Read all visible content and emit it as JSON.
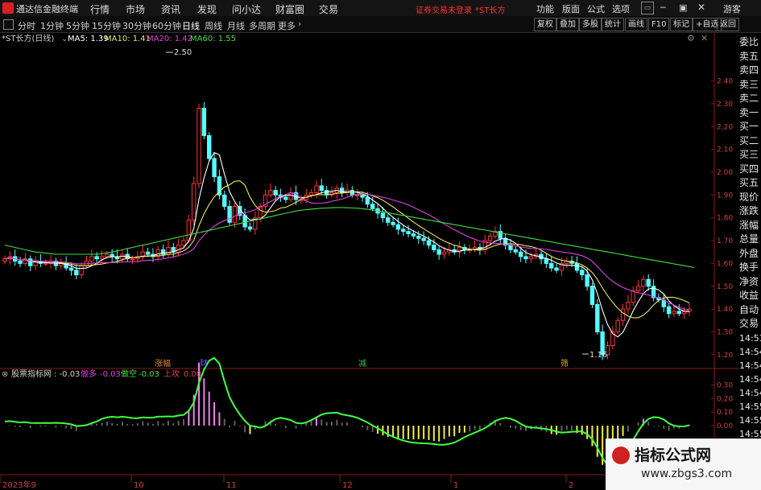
{
  "window": {
    "app_title": "通达信金融终端",
    "menu": [
      "行情",
      "市场",
      "资讯",
      "发现",
      "问小达",
      "财富圈",
      "交易"
    ],
    "alert": "证券交易未登录",
    "alert_stock": "*ST长方",
    "right_menu": [
      "功能",
      "版面",
      "公式",
      "选项"
    ],
    "guest": "游客"
  },
  "toolbar": {
    "timeframes": [
      "分时",
      "1分钟",
      "5分钟",
      "15分钟",
      "30分钟",
      "60分钟",
      "日线",
      "周线",
      "月线",
      "多周期",
      "更多"
    ],
    "active": "日线",
    "right_buttons": [
      "复权",
      "叠加",
      "多股",
      "统计",
      "画线",
      "F10",
      "标记",
      "+自选",
      "返回"
    ]
  },
  "main_chart": {
    "name": "*ST长方(日线)",
    "ma5": "MA5: 1.39",
    "ma10": "MA10: 1.41",
    "ma20": "MA20: 1.42",
    "ma60": "MA60: 1.55",
    "ma5_color": "#ffffff",
    "ma10_color": "#e8e860",
    "ma20_color": "#e040e0",
    "ma60_color": "#40e040",
    "high_label": "2.50",
    "low_label": "1.16",
    "y_ticks": [
      "2.40",
      "2.30",
      "2.20",
      "2.10",
      "2.00",
      "1.90",
      "1.80",
      "1.70",
      "1.60",
      "1.50",
      "1.40",
      "1.30",
      "1.20"
    ],
    "event_markers": [
      "涨幅",
      "财",
      "减",
      "筛"
    ]
  },
  "indicator": {
    "name": "股票指标网",
    "value": ": -0.03",
    "bull_label": "做多",
    "bull_value": "-0.03",
    "bear_label": "做空",
    "bear_value": "-0.03",
    "up_label": "上攻",
    "up_value": "0.00",
    "y_ticks": [
      "0.30",
      "0.20",
      "0.10",
      "0.00"
    ]
  },
  "x_axis": {
    "labels": [
      "2023年9",
      "10",
      "11",
      "12",
      "1",
      "2"
    ]
  },
  "sidebar": {
    "items": [
      "委比",
      "卖五",
      "卖四",
      "卖三",
      "卖二",
      "卖一",
      "买一",
      "买二",
      "买三",
      "买四",
      "买五",
      "现价",
      "涨跌",
      "涨幅",
      "总量",
      "外盘",
      "换手",
      "净资",
      "收益",
      "自动",
      "交易"
    ],
    "times": [
      "14:53",
      "14:54",
      "14:54",
      "14:54",
      "14:54",
      "14:55",
      "14:55",
      "14:55",
      "14:55"
    ]
  },
  "watermark": {
    "line1": "指标公式网",
    "line2": "www.zbgs3.com"
  },
  "chart_data": {
    "type": "candlestick",
    "title": "*ST长方(日线)",
    "ylim": [
      1.15,
      2.55
    ],
    "close": [
      1.62,
      1.63,
      1.61,
      1.6,
      1.62,
      1.59,
      1.61,
      1.6,
      1.6,
      1.61,
      1.59,
      1.6,
      1.58,
      1.57,
      1.55,
      1.59,
      1.61,
      1.63,
      1.62,
      1.63,
      1.64,
      1.63,
      1.62,
      1.64,
      1.62,
      1.62,
      1.63,
      1.65,
      1.64,
      1.63,
      1.66,
      1.64,
      1.67,
      1.65,
      1.68,
      1.7,
      1.79,
      1.95,
      2.28,
      2.16,
      2.06,
      1.98,
      1.9,
      1.85,
      1.78,
      1.85,
      1.81,
      1.76,
      1.75,
      1.8,
      1.85,
      1.9,
      1.92,
      1.9,
      1.89,
      1.88,
      1.91,
      1.88,
      1.88,
      1.9,
      1.91,
      1.94,
      1.92,
      1.9,
      1.91,
      1.93,
      1.91,
      1.92,
      1.9,
      1.9,
      1.89,
      1.86,
      1.84,
      1.82,
      1.8,
      1.78,
      1.77,
      1.75,
      1.74,
      1.73,
      1.72,
      1.71,
      1.7,
      1.68,
      1.66,
      1.64,
      1.65,
      1.66,
      1.65,
      1.67,
      1.66,
      1.66,
      1.67,
      1.66,
      1.7,
      1.72,
      1.74,
      1.71,
      1.68,
      1.66,
      1.65,
      1.63,
      1.62,
      1.63,
      1.64,
      1.62,
      1.6,
      1.58,
      1.57,
      1.6,
      1.61,
      1.6,
      1.57,
      1.55,
      1.5,
      1.42,
      1.3,
      1.2,
      1.24,
      1.3,
      1.35,
      1.4,
      1.43,
      1.48,
      1.5,
      1.53,
      1.5,
      1.45,
      1.44,
      1.41,
      1.38,
      1.39,
      1.38,
      1.39,
      1.4
    ],
    "ma60": [
      1.68,
      1.675,
      1.67,
      1.665,
      1.66,
      1.655,
      1.65,
      1.648,
      1.645,
      1.643,
      1.64,
      1.64,
      1.64,
      1.64,
      1.64,
      1.64,
      1.64,
      1.64,
      1.64,
      1.643,
      1.646,
      1.65,
      1.655,
      1.66,
      1.665,
      1.67,
      1.675,
      1.68,
      1.685,
      1.69,
      1.695,
      1.7,
      1.705,
      1.71,
      1.715,
      1.72,
      1.725,
      1.73,
      1.735,
      1.74,
      1.745,
      1.75,
      1.755,
      1.76,
      1.765,
      1.77,
      1.775,
      1.78,
      1.785,
      1.79,
      1.795,
      1.8,
      1.805,
      1.81,
      1.815,
      1.82,
      1.825,
      1.83,
      1.833,
      1.836,
      1.838,
      1.84,
      1.842,
      1.843,
      1.844,
      1.845,
      1.845,
      1.844,
      1.843,
      1.842,
      1.84,
      1.837,
      1.834,
      1.83,
      1.826,
      1.822,
      1.818,
      1.814,
      1.81,
      1.806,
      1.802,
      1.798,
      1.794,
      1.79,
      1.786,
      1.782,
      1.778,
      1.774,
      1.77,
      1.766,
      1.762,
      1.758,
      1.754,
      1.75,
      1.746,
      1.742,
      1.738,
      1.734,
      1.73,
      1.726,
      1.722,
      1.718,
      1.714,
      1.71,
      1.706,
      1.702,
      1.698,
      1.694,
      1.69,
      1.686,
      1.682,
      1.678,
      1.674,
      1.67,
      1.666,
      1.662,
      1.658,
      1.654,
      1.65,
      1.646,
      1.642,
      1.638,
      1.634,
      1.63,
      1.626,
      1.622,
      1.618,
      1.614,
      1.61,
      1.606,
      1.602,
      1.598,
      1.594,
      1.59,
      1.586,
      1.582
    ]
  }
}
